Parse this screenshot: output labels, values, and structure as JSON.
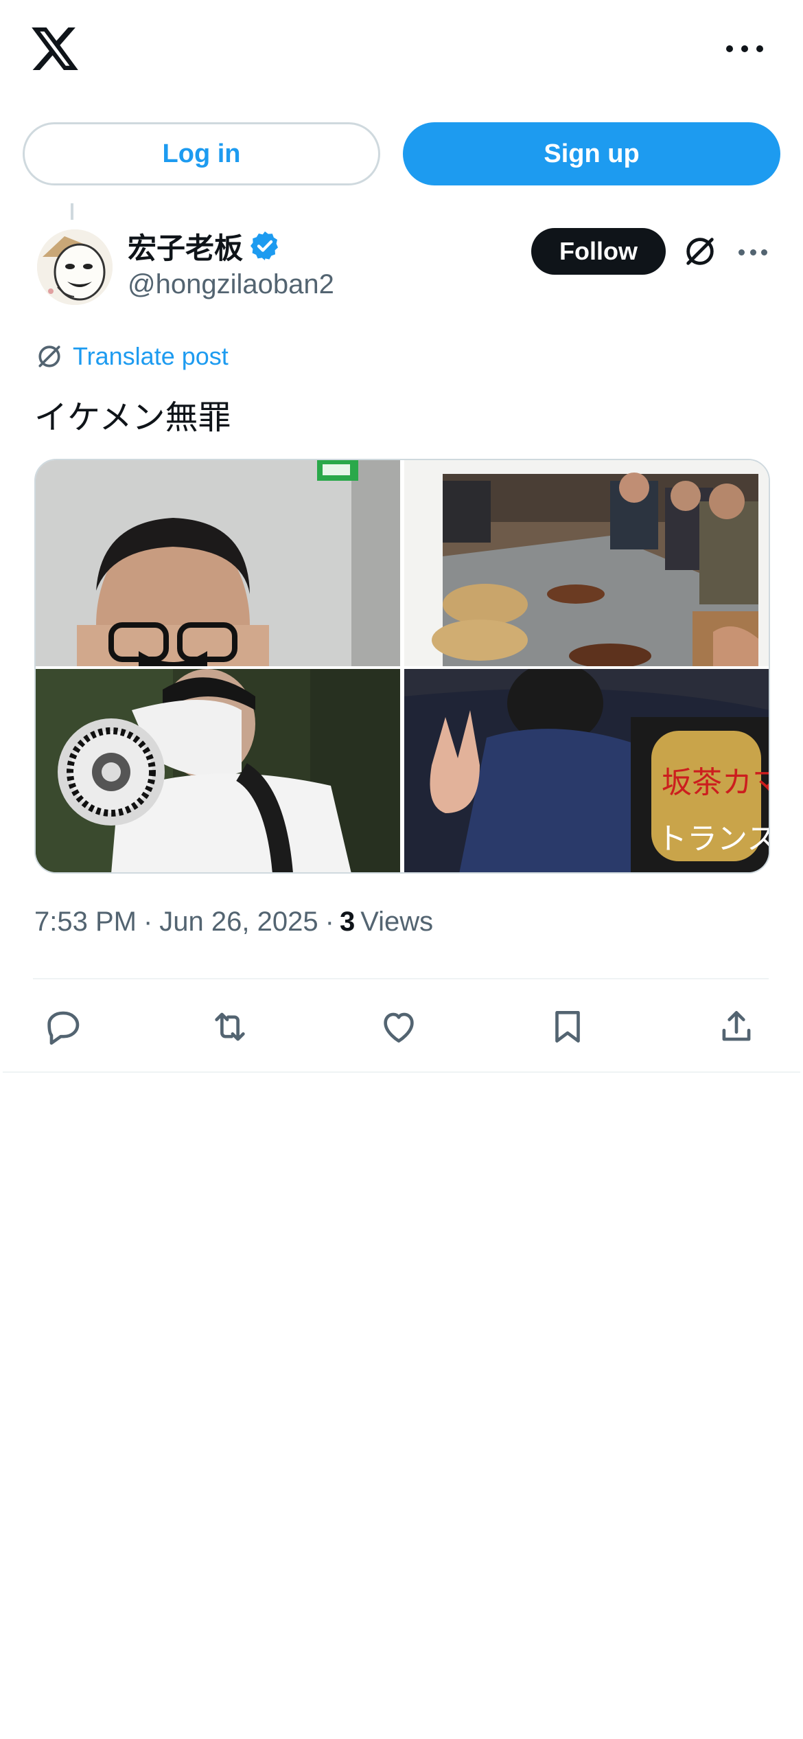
{
  "header": {
    "logo_icon": "x-logo-icon",
    "more_icon": "more-horizontal-icon"
  },
  "auth": {
    "login_label": "Log in",
    "signup_label": "Sign up"
  },
  "post": {
    "author": {
      "display_name": "宏子老板",
      "handle": "@hongzilaoban2",
      "verified": true
    },
    "follow_label": "Follow",
    "translate_label": "Translate post",
    "text": "イケメン無罪",
    "sign_text_1": "坂茶カマ",
    "sign_text_2": "トランス差",
    "time": "7:53 PM",
    "separator": "·",
    "date": "Jun 26, 2025",
    "views_count": "3",
    "views_label": "Views"
  },
  "actions": [
    {
      "icon": "reply-icon"
    },
    {
      "icon": "repost-icon"
    },
    {
      "icon": "like-icon"
    },
    {
      "icon": "bookmark-icon"
    },
    {
      "icon": "share-icon"
    }
  ],
  "colors": {
    "accent": "#1d9bf0",
    "text": "#0f1419",
    "secondary": "#536471",
    "border": "#cfd9de"
  }
}
